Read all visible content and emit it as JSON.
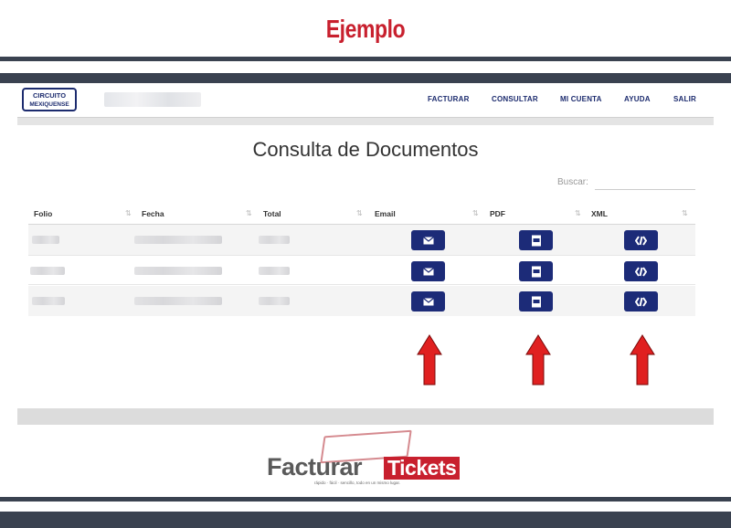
{
  "header": {
    "title": "Ejemplo"
  },
  "app": {
    "logo": {
      "line1": "CIRCUITO",
      "line2": "MEXIQUENSE"
    },
    "nav": [
      "FACTURAR",
      "CONSULTAR",
      "MI CUENTA",
      "AYUDA",
      "SALIR"
    ]
  },
  "page": {
    "title": "Consulta de Documentos",
    "search_label": "Buscar:",
    "search_value": ""
  },
  "table": {
    "columns": [
      "Folio",
      "Fecha",
      "Total",
      "Email",
      "PDF",
      "XML"
    ],
    "row_count": 3,
    "actions": {
      "email": "envelope-icon",
      "pdf": "pdf-file-icon",
      "xml": "code-link-icon"
    }
  },
  "annotation": {
    "arrow_color": "#e02020"
  },
  "brand": {
    "word": "Facturar",
    "highlight": "Tickets",
    "tagline": "rápido · fácil · sencillo, todo en un mismo lugar.",
    "accent": "#c8202e"
  },
  "colors": {
    "button": "#1c2b78",
    "band": "#3a4250",
    "title_red": "#c8202e"
  }
}
